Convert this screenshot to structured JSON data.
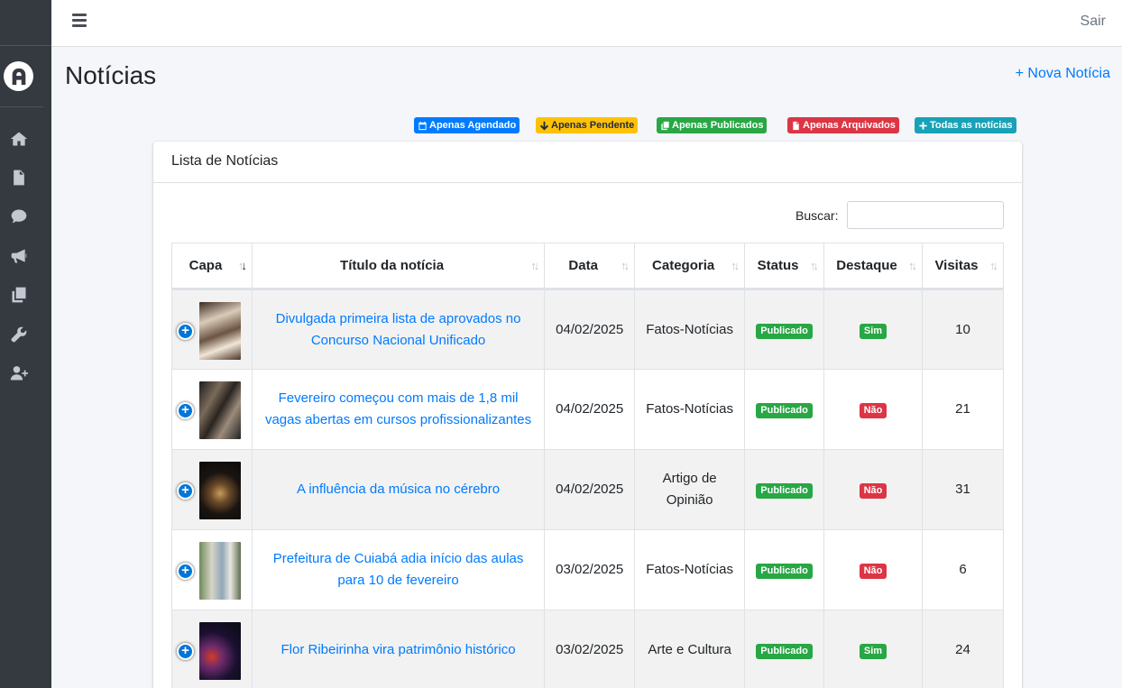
{
  "header": {
    "menu_icon": "bars-icon",
    "logout_label": "Sair"
  },
  "sidebar": {
    "logo_icon": "logo-a-icon",
    "items": [
      {
        "icon": "home-icon"
      },
      {
        "icon": "file-icon"
      },
      {
        "icon": "comment-icon"
      },
      {
        "icon": "bullhorn-icon"
      },
      {
        "icon": "copy-icon"
      },
      {
        "icon": "wrench-icon"
      },
      {
        "icon": "user-plus-icon"
      }
    ]
  },
  "page": {
    "title": "Notícias",
    "new_link": "+ Nova Notícia"
  },
  "filters": [
    {
      "label": "Apenas Agendado",
      "icon": "calendar-icon",
      "color": "#007bff"
    },
    {
      "label": "Apenas Pendente",
      "icon": "arrow-down-icon",
      "color": "#ffc107"
    },
    {
      "label": "Apenas Publicados",
      "icon": "copy-icon",
      "color": "#28a745"
    },
    {
      "label": "Apenas Arquivados",
      "icon": "file-icon",
      "color": "#dc3545"
    },
    {
      "label": "Todas as notícias",
      "icon": "plus-icon",
      "color": "#17a2b8"
    }
  ],
  "card": {
    "title": "Lista de Notícias",
    "search_label": "Buscar:",
    "search_value": ""
  },
  "table": {
    "columns": [
      "Capa",
      "Título da notícia",
      "Data",
      "Categoria",
      "Status",
      "Destaque",
      "Visitas"
    ],
    "rows": [
      {
        "title": "Divulgada primeira lista de aprovados no Concurso Nacional Unificado",
        "date": "04/02/2025",
        "category": "Fatos-Notícias",
        "status": "Publicado",
        "featured": "Sim",
        "visits": "10"
      },
      {
        "title": "Fevereiro começou com mais de 1,8 mil vagas abertas em cursos profissionalizantes",
        "date": "04/02/2025",
        "category": "Fatos-Notícias",
        "status": "Publicado",
        "featured": "Não",
        "visits": "21"
      },
      {
        "title": "A influência da música no cérebro",
        "date": "04/02/2025",
        "category": "Artigo de Opinião",
        "status": "Publicado",
        "featured": "Não",
        "visits": "31"
      },
      {
        "title": "Prefeitura de Cuiabá adia início das aulas para 10 de fevereiro",
        "date": "03/02/2025",
        "category": "Fatos-Notícias",
        "status": "Publicado",
        "featured": "Não",
        "visits": "6"
      },
      {
        "title": "Flor Ribeirinha vira patrimônio histórico",
        "date": "03/02/2025",
        "category": "Arte e Cultura",
        "status": "Publicado",
        "featured": "Sim",
        "visits": "24"
      }
    ]
  },
  "colors": {
    "sidebar": "#343a40",
    "link": "#007bff",
    "success": "#28a745",
    "danger": "#dc3545"
  }
}
